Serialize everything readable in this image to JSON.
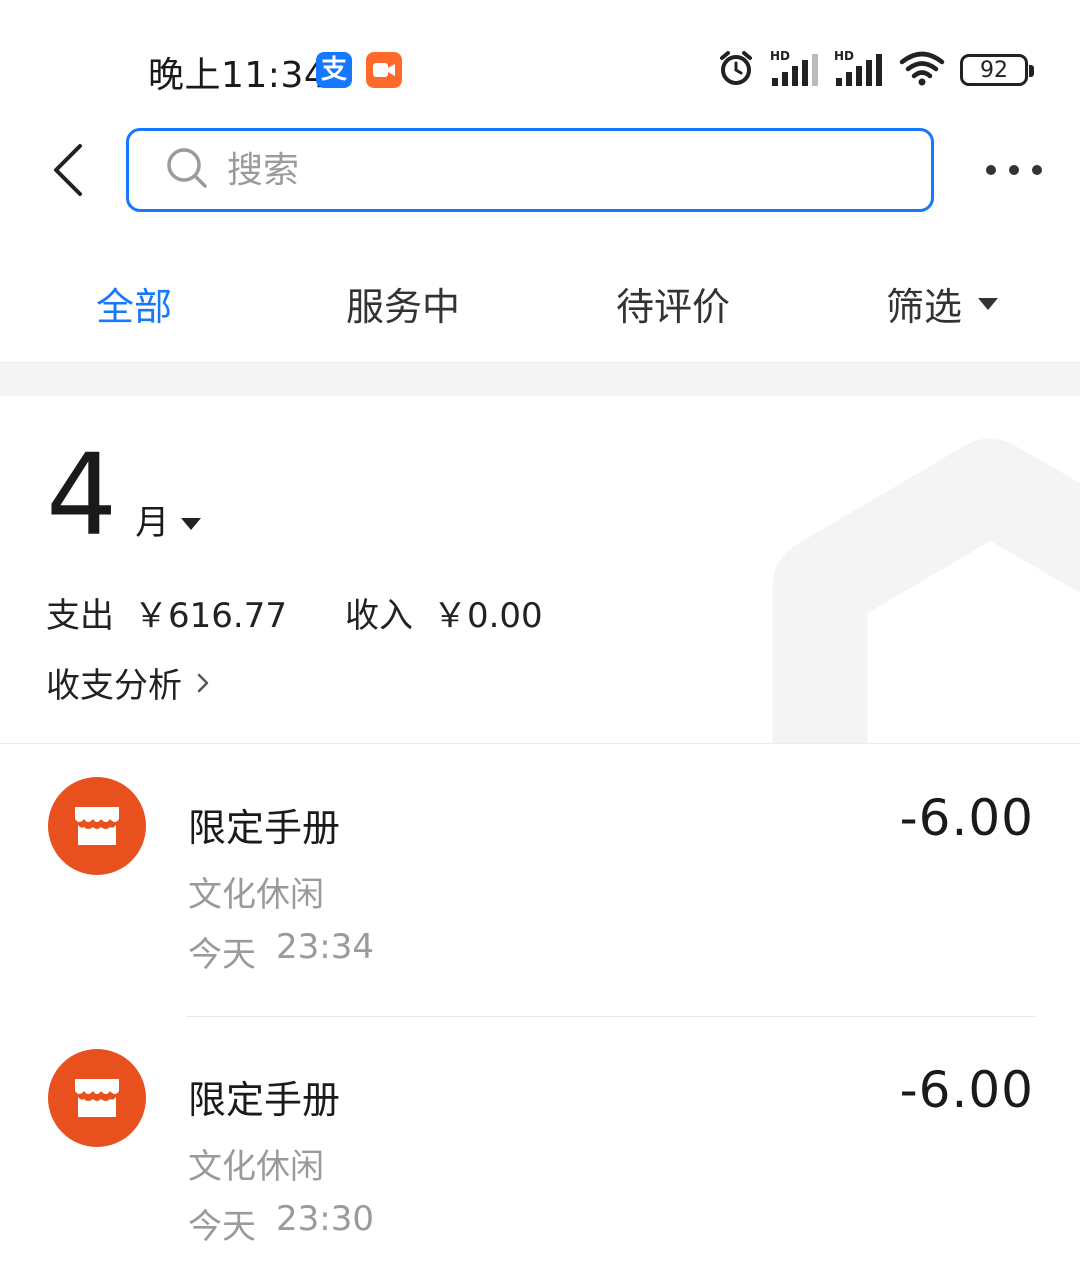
{
  "status_bar": {
    "time": "晚上11:34",
    "alipay_badge_glyph": "支",
    "battery": "92",
    "icons": [
      "alarm-icon",
      "signal-hd-icon",
      "signal-hd-icon",
      "wifi-icon",
      "battery-icon"
    ]
  },
  "header": {
    "search_placeholder": "搜索"
  },
  "tabs": [
    {
      "label": "全部",
      "active": true
    },
    {
      "label": "服务中",
      "active": false
    },
    {
      "label": "待评价",
      "active": false
    },
    {
      "label": "筛选",
      "active": false
    }
  ],
  "summary": {
    "month_number": "4",
    "month_unit": "月",
    "expense_label": "支出",
    "expense_amount": "￥616.77",
    "income_label": "收入",
    "income_amount": "￥0.00",
    "analysis_link": "收支分析"
  },
  "transactions": [
    {
      "title": "限定手册",
      "category": "文化休闲",
      "day": "今天",
      "time": "23:34",
      "amount": "-6.00"
    },
    {
      "title": "限定手册",
      "category": "文化休闲",
      "day": "今天",
      "time": "23:30",
      "amount": "-6.00"
    }
  ],
  "colors": {
    "accent": "#1677ff",
    "shop_icon": "#e8511e",
    "video_badge": "#ff6a2b"
  }
}
